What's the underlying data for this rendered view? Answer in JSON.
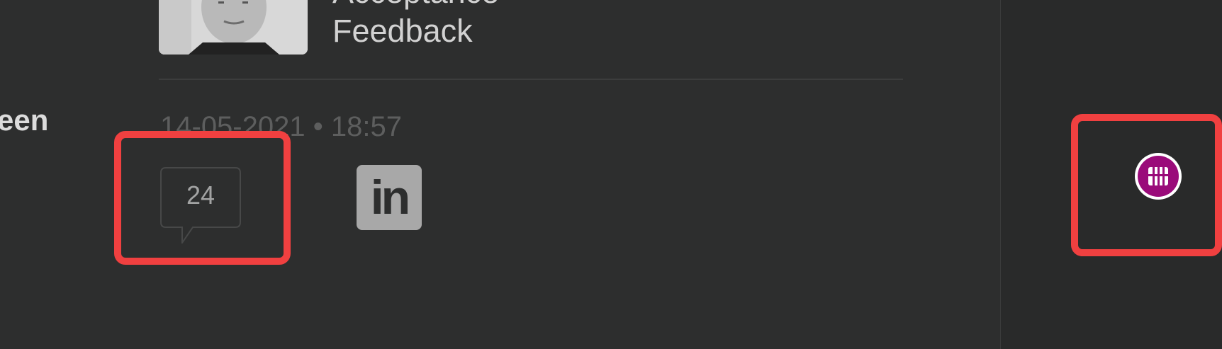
{
  "sidebar": {
    "partial_label": "een"
  },
  "post": {
    "title_partial_above": "Acceptance",
    "title_line": "Feedback",
    "date_text": "14-05-2021 • 18:57",
    "comment_count": "24",
    "linkedin_label": "in"
  },
  "colors": {
    "background": "#2d2e2e",
    "right_rail": "#292a2a",
    "highlight": "#f04040",
    "widget_accent": "#9a0b7a",
    "linkedin_badge": "#a8a8a8"
  },
  "icons": {
    "comment": "speech-bubble-icon",
    "linkedin": "linkedin-icon",
    "widget": "chat-widget-icon"
  }
}
